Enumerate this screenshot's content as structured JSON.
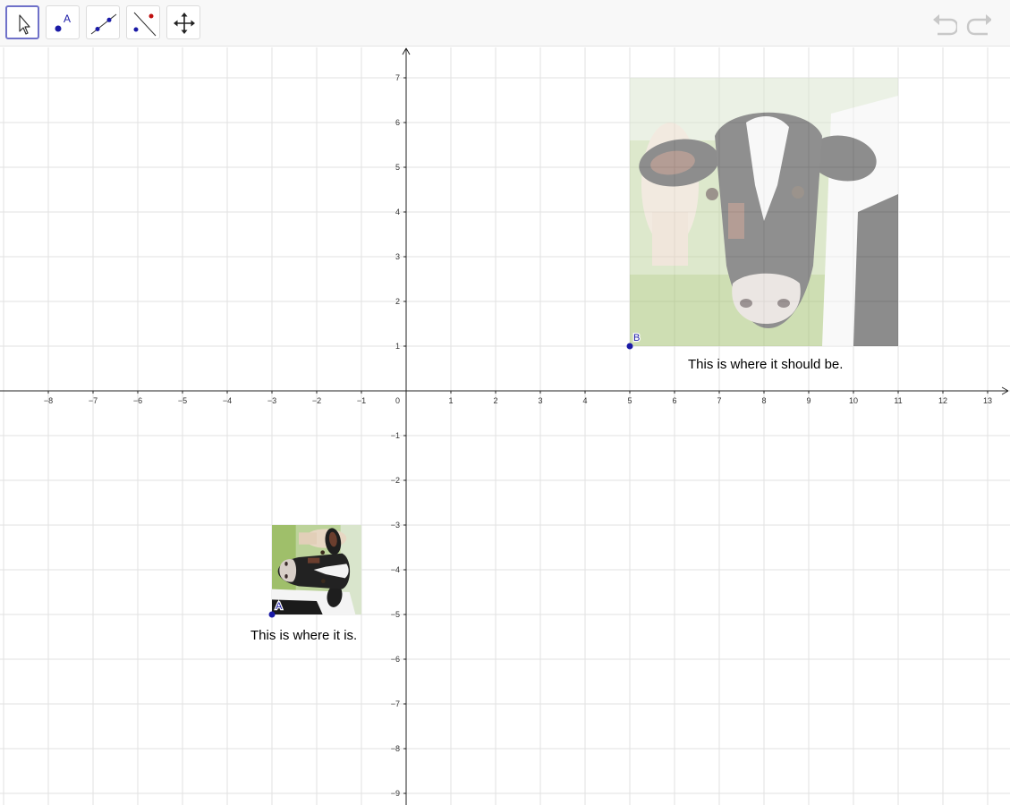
{
  "toolbar": {
    "tools": [
      {
        "name": "move-tool",
        "icon": "arrow-pointer-icon",
        "active": true
      },
      {
        "name": "point-tool",
        "icon": "point-with-label-icon",
        "active": false
      },
      {
        "name": "line-tool",
        "icon": "line-through-two-points-icon",
        "active": false
      },
      {
        "name": "perpendicular-tool",
        "icon": "perpendicular-line-icon",
        "active": false
      },
      {
        "name": "move-graphics-view-tool",
        "icon": "four-way-arrows-icon",
        "active": false
      }
    ],
    "undo_icon": "undo-icon",
    "redo_icon": "redo-icon"
  },
  "graph": {
    "x_range": [
      -9,
      13.5
    ],
    "y_range": [
      -9.2,
      7.7
    ],
    "x_ticks": [
      "−8",
      "−7",
      "−6",
      "−5",
      "−4",
      "−3",
      "−2",
      "−1",
      "1",
      "2",
      "3",
      "4",
      "5",
      "6",
      "7",
      "8",
      "9",
      "10",
      "11",
      "12",
      "13"
    ],
    "y_ticks": [
      "7",
      "6",
      "5",
      "4",
      "3",
      "2",
      "1",
      "−1",
      "−2",
      "−3",
      "−4",
      "−5",
      "−6",
      "−7",
      "−8",
      "−9"
    ],
    "origin_label": "0",
    "grid": true
  },
  "points": {
    "A": {
      "label": "A",
      "x": -3,
      "y": -5,
      "color": "#1a1aa6"
    },
    "B": {
      "label": "B",
      "x": 5,
      "y": 1,
      "color": "#1a1aa6"
    }
  },
  "images": {
    "small": {
      "content": "cow-photo-rotated-icon",
      "anchor": "A",
      "width_units": 2,
      "height_units": 2,
      "rotation_deg": 90
    },
    "large": {
      "content": "cow-photo-icon",
      "anchor": "B",
      "width_units": 6,
      "height_units": 6,
      "opacity": 0.5
    }
  },
  "texts": {
    "actual": "This is where it is.",
    "target": "This is where it should be."
  }
}
